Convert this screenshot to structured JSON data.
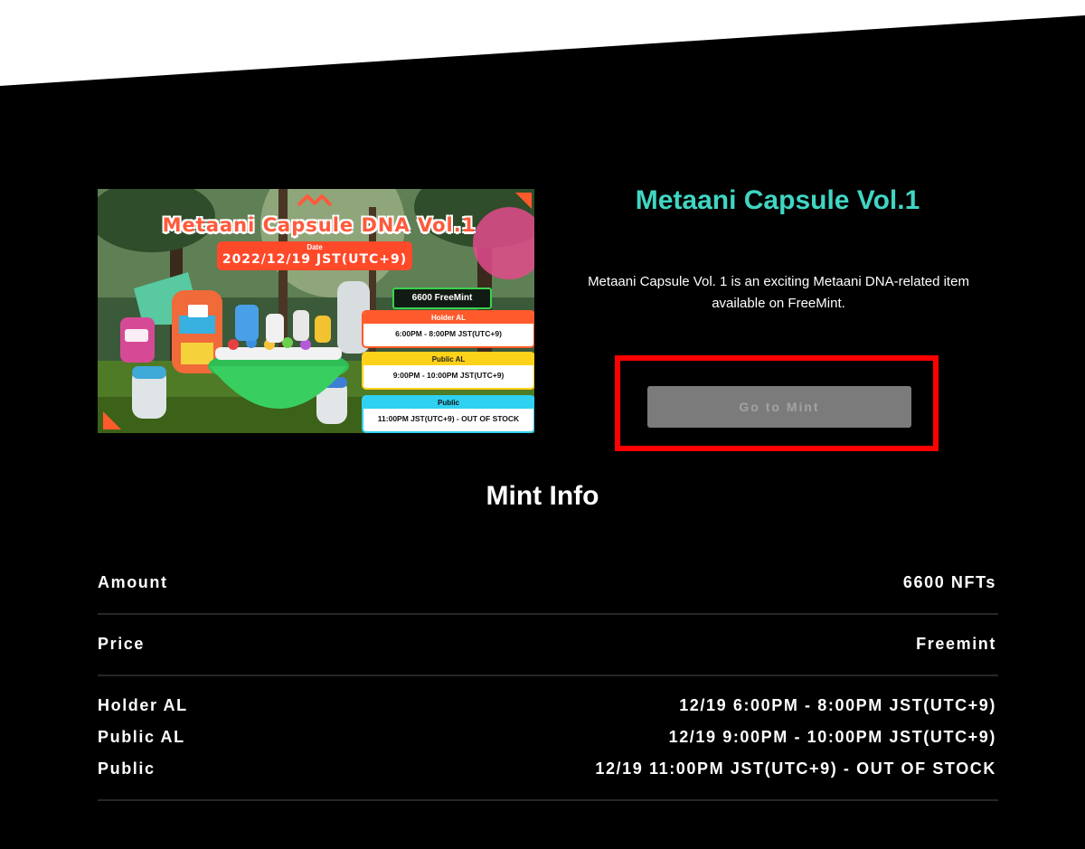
{
  "banner": {
    "title": "Metaani Capsule DNA Vol.1",
    "date_label": "Date",
    "date_value": "2022/12/19 JST(UTC+9)",
    "freemint_badge": "6600 FreeMint",
    "slots": [
      {
        "name": "Holder AL",
        "time": "6:00PM - 8:00PM JST(UTC+9)"
      },
      {
        "name": "Public AL",
        "time": "9:00PM - 10:00PM JST(UTC+9)"
      },
      {
        "name": "Public",
        "time": "11:00PM JST(UTC+9) - OUT OF STOCK"
      }
    ]
  },
  "item": {
    "title": "Metaani Capsule Vol.1",
    "description": "Metaani Capsule Vol. 1 is an exciting Metaani DNA-related item available on FreeMint.",
    "mint_button_label": "Go to Mint"
  },
  "mint_info": {
    "title": "Mint Info",
    "amount_label": "Amount",
    "amount_value": "6600 NFTs",
    "price_label": "Price",
    "price_value": "Freemint",
    "schedule": [
      {
        "label": "Holder AL",
        "value": "12/19 6:00PM - 8:00PM JST(UTC+9)"
      },
      {
        "label": "Public AL",
        "value": "12/19 9:00PM - 10:00PM JST(UTC+9)"
      },
      {
        "label": "Public",
        "value": "12/19 11:00PM JST(UTC+9) - OUT OF STOCK"
      }
    ]
  },
  "colors": {
    "title_accent": "#3fd6c3",
    "highlight_border": "#ff0000",
    "button_bg": "#7b7b7b",
    "background": "#000000"
  }
}
